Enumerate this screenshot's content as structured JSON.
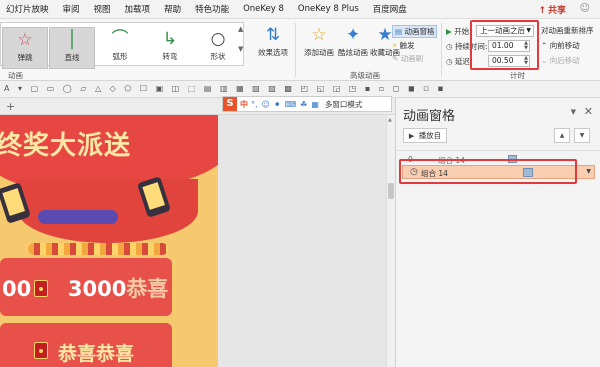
{
  "menu": {
    "items": [
      "幻灯片放映",
      "审阅",
      "视图",
      "加载项",
      "帮助",
      "特色功能",
      "OneKey 8",
      "OneKey 8 Plus",
      "百度网盘"
    ],
    "share_label": "共享"
  },
  "ribbon": {
    "gallery": [
      {
        "label": "弹跳",
        "icon": "bounce-star-icon"
      },
      {
        "label": "直线",
        "icon": "line-path-icon"
      },
      {
        "label": "弧形",
        "icon": "arc-path-icon"
      },
      {
        "label": "转弯",
        "icon": "turn-path-icon"
      },
      {
        "label": "形状",
        "icon": "shape-path-icon"
      }
    ],
    "effect_options_label": "效果选项",
    "group_animation_label": "动画",
    "add_animation_label": "添加动画",
    "painter_label": "动画刷",
    "anim_painter_label": "动画刷",
    "add_anim_main": "添加动画",
    "brush_label": "酷炫动画",
    "favorite_label": "收藏动画",
    "pane_toggle_label": "动画窗格",
    "trigger_label": "触发",
    "adv_group_label": "高级动画",
    "start_label": "开始:",
    "start_value": "上一动画之后",
    "duration_label": "持续时间:",
    "duration_value": "01.00",
    "delay_label": "延迟:",
    "delay_value": "00.50",
    "timing_group_label": "计时",
    "reorder_label": "对动画重新排序",
    "move_earlier_label": "向前移动",
    "move_later_label": "向后移动"
  },
  "sogou": {
    "mode_label": "中",
    "window_mode_label": "多窗口模式"
  },
  "slide": {
    "banner_text": "终奖大派送",
    "card1_prefix": "00",
    "card1_amount": "3000",
    "card1_suffix": "恭喜",
    "card2_text": "恭喜恭喜"
  },
  "animation_pane": {
    "title": "动画窗格",
    "play_label": "播放自",
    "rows": [
      {
        "index": "0",
        "label": "组合 14"
      },
      {
        "label": "组合 14"
      }
    ]
  }
}
